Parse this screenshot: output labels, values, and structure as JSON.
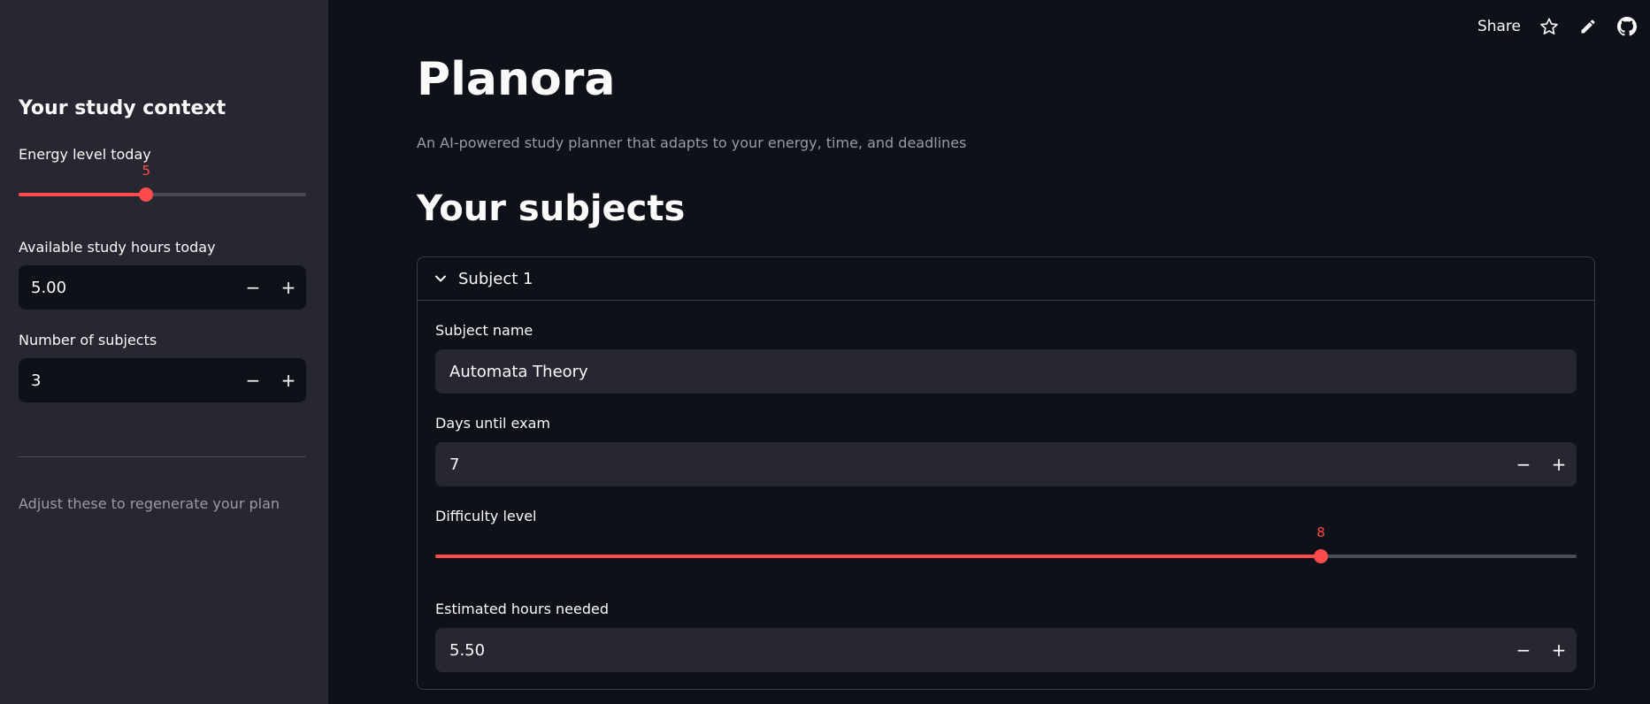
{
  "header": {
    "share_label": "Share",
    "icons": [
      "star-icon",
      "pencil-icon",
      "github-icon"
    ]
  },
  "sidebar": {
    "title": "Your study context",
    "energy": {
      "label": "Energy level today",
      "value": "5",
      "min": 1,
      "max": 10,
      "fraction": 0.444
    },
    "hours": {
      "label": "Available study hours today",
      "value": "5.00"
    },
    "subjects_count": {
      "label": "Number of subjects",
      "value": "3"
    },
    "caption": "Adjust these to regenerate your plan"
  },
  "main": {
    "title": "Planora",
    "subtitle": "An AI-powered study planner that adapts to your energy, time, and deadlines",
    "section_title": "Your subjects",
    "expander": {
      "label": "Subject 1",
      "subject_name": {
        "label": "Subject name",
        "value": "Automata Theory"
      },
      "days_until_exam": {
        "label": "Days until exam",
        "value": "7"
      },
      "difficulty": {
        "label": "Difficulty level",
        "value": "8",
        "min": 1,
        "max": 10,
        "fraction": 0.776
      },
      "hours_needed": {
        "label": "Estimated hours needed",
        "value": "5.50"
      }
    }
  },
  "colors": {
    "accent": "#ff4b4b",
    "background": "#0e1117",
    "sidebar": "#262730",
    "input_bg": "#262730",
    "muted_text": "#9a9ba3"
  },
  "stepper": {
    "minus": "−",
    "plus": "+"
  }
}
